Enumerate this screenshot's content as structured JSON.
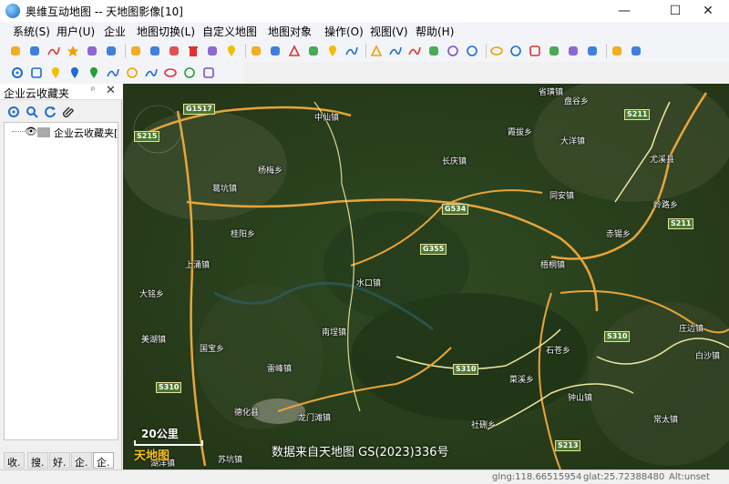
{
  "window": {
    "title": "奥维互动地图 -- 天地图影像[10]",
    "controls": [
      "—",
      "☐",
      "✕"
    ]
  },
  "menu": [
    "系统(S)",
    "用户(U)",
    "企业",
    "地图切换(L)",
    "自定义地图",
    "地图对象",
    "操作(O)",
    "视图(V)",
    "帮助(H)"
  ],
  "toolbar1_icons": [
    "open-folder",
    "save",
    "search",
    "favorite-star",
    "route",
    "3d-globe",
    "capture",
    "undo",
    "redo",
    "delete",
    "eraser",
    "placemark",
    "ruler",
    "layer",
    "polygon",
    "chat-bubble",
    "pin",
    "polyline",
    "triangle",
    "curve",
    "arc",
    "points",
    "circle",
    "ring",
    "ellipse",
    "dot",
    "box",
    "columns",
    "grid",
    "message",
    "info",
    "diamond"
  ],
  "toolbar2_icons": [
    "settings",
    "document",
    "pin-yellow",
    "pin-blue",
    "pin-green",
    "line",
    "circle",
    "arc",
    "ellipse",
    "circle2",
    "square"
  ],
  "side_panel": {
    "title": "企业云收藏夹",
    "pin": "ᵖ",
    "close": "✕",
    "tree_item": "企业云收藏夹[",
    "tabs": [
      "收.",
      "搜.",
      "好.",
      "企.",
      "企."
    ]
  },
  "map": {
    "places": [
      {
        "name": "中仙镇"
      },
      {
        "name": "杨梅乡"
      },
      {
        "name": "葛坑镇"
      },
      {
        "name": "桂阳乡"
      },
      {
        "name": "上涌镇"
      },
      {
        "name": "大铭乡"
      },
      {
        "name": "美湖镇"
      },
      {
        "name": "国宝乡"
      },
      {
        "name": "雷峰镇"
      },
      {
        "name": "南埕镇"
      },
      {
        "name": "水口镇"
      },
      {
        "name": "长庆镇"
      },
      {
        "name": "霞拔乡"
      },
      {
        "name": "盘谷乡"
      },
      {
        "name": "省璜镇"
      },
      {
        "name": "大洋镇"
      },
      {
        "name": "同安镇"
      },
      {
        "name": "尤溪县"
      },
      {
        "name": "岭路乡"
      },
      {
        "name": "赤锡乡"
      },
      {
        "name": "梧桐镇"
      },
      {
        "name": "庄边镇"
      },
      {
        "name": "白沙镇"
      },
      {
        "name": "石苍乡"
      },
      {
        "name": "菜溪乡"
      },
      {
        "name": "钟山镇"
      },
      {
        "name": "常太镇"
      },
      {
        "name": "龙门滩镇"
      },
      {
        "name": "社硎乡"
      },
      {
        "name": "德化县"
      },
      {
        "name": "苏坑镇"
      },
      {
        "name": "湖洋镇"
      }
    ],
    "shields": [
      {
        "label": "G1517"
      },
      {
        "label": "S215"
      },
      {
        "label": "S211"
      },
      {
        "label": "G534"
      },
      {
        "label": "G355"
      },
      {
        "label": "S211"
      },
      {
        "label": "S310"
      },
      {
        "label": "S310"
      },
      {
        "label": "S310"
      },
      {
        "label": "S213"
      }
    ],
    "scale": "20公里",
    "attribution": "数据来自天地图 GS(2023)336号",
    "logo": "天地图"
  },
  "status": {
    "glng": "glng:118.66515954",
    "glat": "glat:25.72388480",
    "alt": "Alt:unset"
  }
}
